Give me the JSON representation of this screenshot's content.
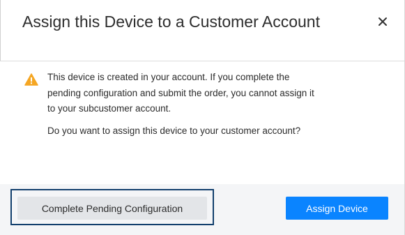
{
  "dialog": {
    "title": "Assign this Device to a Customer Account",
    "close_icon": "close-icon",
    "warning_icon": "warning-triangle-icon",
    "message_lines": [
      "This device is created in your account. If you complete the",
      "pending configuration and submit the order, you cannot assign it",
      "to your subcustomer account."
    ],
    "question": "Do you want to assign this device to your customer account?",
    "secondary_button_label": "Complete Pending Configuration",
    "primary_button_label": "Assign Device"
  },
  "colors": {
    "warning": "#f5a623",
    "primary": "#0a84ff",
    "focus_ring": "#123f6d",
    "footer_bg": "#f4f5f7"
  }
}
